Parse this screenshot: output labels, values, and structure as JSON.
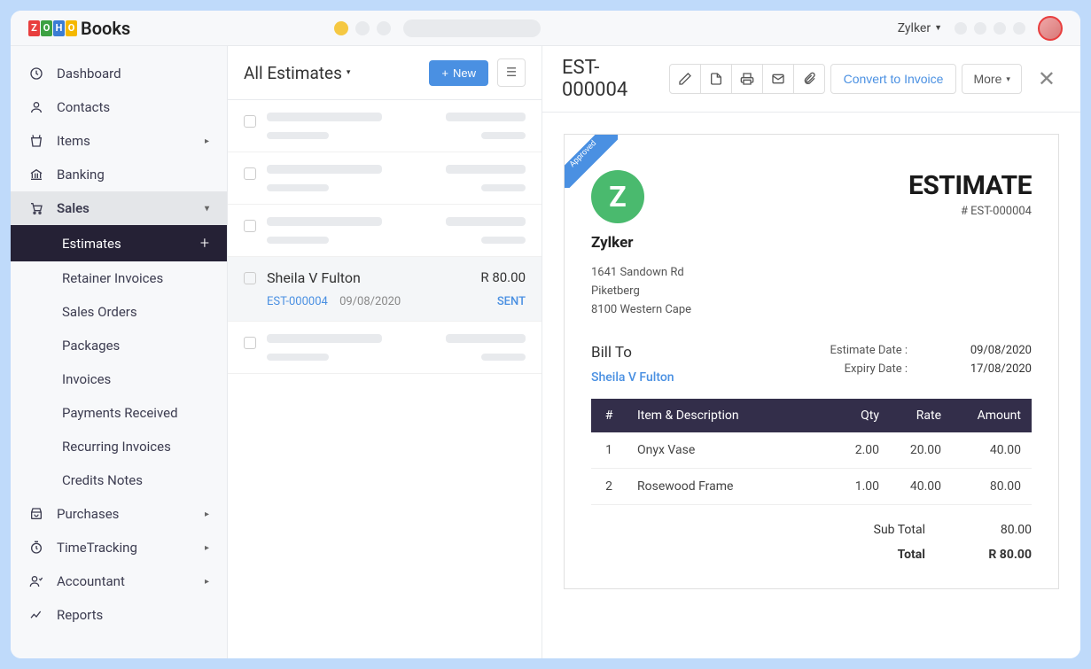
{
  "app": {
    "name": "Books",
    "org": "Zylker"
  },
  "sidebar": {
    "items": [
      {
        "label": "Dashboard"
      },
      {
        "label": "Contacts"
      },
      {
        "label": "Items"
      },
      {
        "label": "Banking"
      },
      {
        "label": "Sales"
      },
      {
        "label": "Purchases"
      },
      {
        "label": "TimeTracking"
      },
      {
        "label": "Accountant"
      },
      {
        "label": "Reports"
      }
    ],
    "sales_sub": [
      {
        "label": "Estimates"
      },
      {
        "label": "Retainer Invoices"
      },
      {
        "label": "Sales Orders"
      },
      {
        "label": "Packages"
      },
      {
        "label": "Invoices"
      },
      {
        "label": "Payments Received"
      },
      {
        "label": "Recurring Invoices"
      },
      {
        "label": "Credits Notes"
      }
    ]
  },
  "list": {
    "title": "All Estimates",
    "new_label": "New",
    "selected": {
      "customer": "Sheila V Fulton",
      "amount": "R 80.00",
      "id": "EST-000004",
      "date": "09/08/2020",
      "status": "SENT"
    }
  },
  "detail": {
    "number": "EST-000004",
    "convert_label": "Convert to Invoice",
    "more_label": "More",
    "ribbon": "Approved",
    "company": {
      "name": "Zylker",
      "logo_letter": "Z",
      "addr1": "1641 Sandown Rd",
      "addr2": "Piketberg",
      "addr3": "8100 Western Cape"
    },
    "doc_title": "ESTIMATE",
    "doc_number": "# EST-000004",
    "billto_heading": "Bill To",
    "billto_name": "Sheila V Fulton",
    "dates": {
      "estimate_label": "Estimate Date :",
      "estimate_value": "09/08/2020",
      "expiry_label": "Expiry Date :",
      "expiry_value": "17/08/2020"
    },
    "headers": {
      "num": "#",
      "item": "Item & Description",
      "qty": "Qty",
      "rate": "Rate",
      "amount": "Amount"
    },
    "lines": [
      {
        "num": "1",
        "item": "Onyx Vase",
        "qty": "2.00",
        "rate": "20.00",
        "amount": "40.00"
      },
      {
        "num": "2",
        "item": "Rosewood Frame",
        "qty": "1.00",
        "rate": "40.00",
        "amount": "80.00"
      }
    ],
    "subtotal_label": "Sub Total",
    "subtotal": "80.00",
    "total_label": "Total",
    "total": "R 80.00"
  }
}
